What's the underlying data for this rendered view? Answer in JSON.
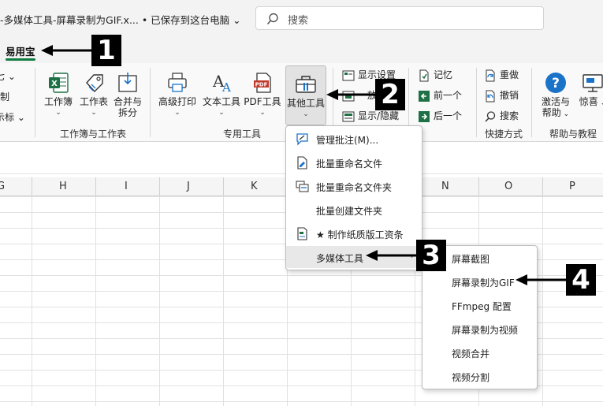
{
  "window": {
    "title": "-多媒体工具-屏幕录制为GIF.x... • 已保存到这台电脑 ⌄"
  },
  "search": {
    "placeholder": "搜索"
  },
  "ribbon_tab": {
    "active": "易用宝"
  },
  "ribbon": {
    "left_cut": [
      "七 ⌄",
      "制",
      "示标 ⌄"
    ],
    "group_workbook": {
      "label": "工作簿与工作表",
      "buttons": [
        "工作簿",
        "工作表",
        "合并与\n拆分"
      ]
    },
    "group_special": {
      "label": "专用工具",
      "buttons": [
        "高级打印",
        "文本工具",
        "PDF工具",
        "其他工具"
      ]
    },
    "group_display": {
      "items": [
        "显示设置",
        "放",
        "显示/隐藏"
      ]
    },
    "group_nav": {
      "items": [
        "记忆",
        "前一个",
        "后一个"
      ]
    },
    "group_shortcut": {
      "label": "快捷方式",
      "items": [
        "重做",
        "撤销",
        "搜索"
      ]
    },
    "group_help": {
      "label": "帮助与教程",
      "buttons": [
        "激活与\n帮助",
        "惊喜"
      ]
    }
  },
  "columns": [
    "G",
    "H",
    "I",
    "J",
    "K",
    "N",
    "O",
    "P"
  ],
  "menu_other_tools": {
    "items": [
      "管理批注(M)...",
      "批量重命名文件",
      "批量重命名文件夹",
      "批量创建文件夹",
      "★ 制作纸质版工资条",
      "多媒体工具"
    ]
  },
  "menu_multimedia": {
    "items": [
      "屏幕截图",
      "屏幕录制为GIF",
      "FFmpeg 配置",
      "屏幕录制为视频",
      "视频合并",
      "视频分割"
    ]
  },
  "callouts": [
    "1",
    "2",
    "3",
    "4"
  ],
  "colors": {
    "accent_green": "#107c41",
    "excel_green": "#1e7145",
    "help_blue": "#1a73c9",
    "callout_black": "#000000"
  }
}
